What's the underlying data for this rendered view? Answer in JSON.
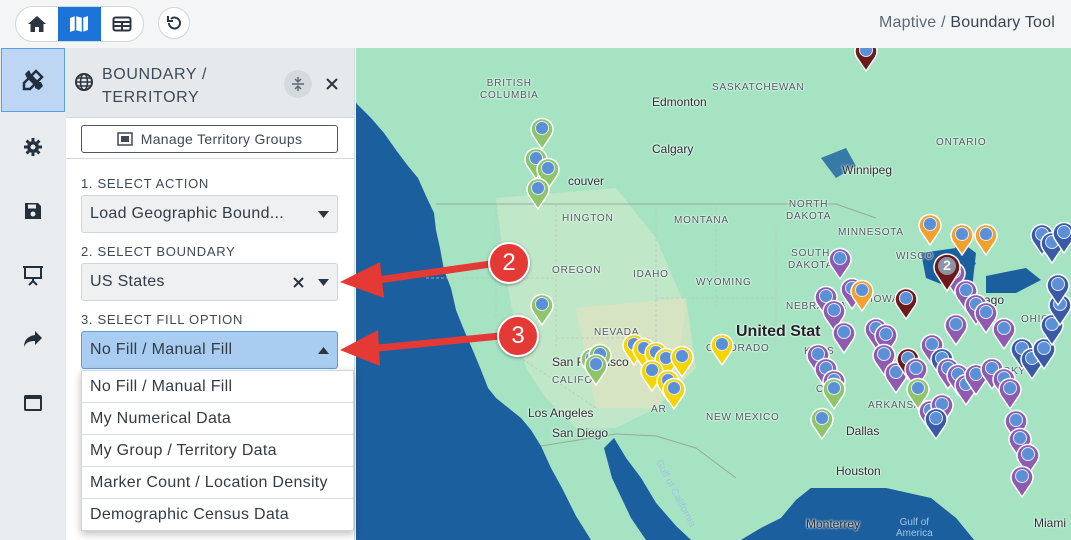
{
  "breadcrumb": {
    "app": "Maptive",
    "separator": "/",
    "current": "Boundary Tool"
  },
  "topbar": {
    "view_buttons": [
      {
        "name": "home-icon",
        "active": false
      },
      {
        "name": "map-icon",
        "active": true
      },
      {
        "name": "table-icon",
        "active": false
      }
    ],
    "undo_icon": "undo-icon"
  },
  "rail": {
    "items": [
      {
        "icon": "tools-icon",
        "active": true
      },
      {
        "icon": "gear-icon",
        "active": false
      },
      {
        "icon": "save-icon",
        "active": false
      },
      {
        "icon": "presentation-icon",
        "active": false
      },
      {
        "icon": "share-icon",
        "active": false
      },
      {
        "icon": "window-icon",
        "active": false
      }
    ]
  },
  "panel": {
    "title_line1": "BOUNDARY /",
    "title_line2": "TERRITORY",
    "manage_button": "Manage Territory Groups",
    "step1_label": "1. SELECT ACTION",
    "step1_value": "Load Geographic Bound...",
    "step2_label": "2. SELECT BOUNDARY",
    "step2_value": "US States",
    "step3_label": "3. SELECT FILL OPTION",
    "step3_value": "No Fill / Manual Fill",
    "fill_options": [
      "No Fill / Manual Fill",
      "My Numerical Data",
      "My Group / Territory Data",
      "Marker Count / Location Density",
      "Demographic Census Data"
    ]
  },
  "callouts": {
    "first": "2",
    "second": "3"
  },
  "map": {
    "cluster_count": "2",
    "labels": {
      "british_columbia": "BRITISH\nCOLUMBIA",
      "saskatchewan": "SASKATCHEWAN",
      "edmonton": "Edmonton",
      "calgary": "Calgary",
      "winnipeg": "Winnipeg",
      "ontario": "ONTARIO",
      "vancouver": "couver",
      "washington": "HINGTON",
      "montana": "MONTANA",
      "north_dakota": "NORTH\nDAKOTA",
      "minnesota": "MINNESOTA",
      "oregon": "OREGON",
      "idaho": "IDAHO",
      "south_dakota": "SOUTH\nDAKOTA",
      "wisconsin": "WISCO",
      "wyoming": "WYOMING",
      "nebraska": "NEBRASKA",
      "iowa": "IOWA",
      "nevada": "NEVADA",
      "united_states": "United Stat",
      "chicago": "cago",
      "ohio": "OHIO",
      "san_francisco": "San Francisco",
      "colorado": "COLORADO",
      "kansas": "KANS",
      "kentucky": "TUCKY",
      "california": "CALIFO",
      "arizona": "AR",
      "oklahoma": "OKLA",
      "arkansas": "ARKANSAS",
      "los_angeles": "Los Angeles",
      "new_mexico": "NEW MEXICO",
      "san_diego": "San Diego",
      "dallas": "Dallas",
      "houston": "Houston",
      "gulf_california": "Gulf of California",
      "monterrey": "Monterrey",
      "gulf_of_america": "Gulf of\nAmerica",
      "miami": "Miami"
    }
  },
  "colors": {
    "accent": "#1c73d8",
    "callout": "#e53935",
    "land": "#a6e3c3",
    "water": "#1c5f9e",
    "pin_green": "#8fc46a",
    "pin_yellow": "#f5d400",
    "pin_purple": "#8e5bb0",
    "pin_orange": "#f2a12e",
    "pin_darkred": "#6e1a1a",
    "pin_navy": "#3b5aa6"
  }
}
